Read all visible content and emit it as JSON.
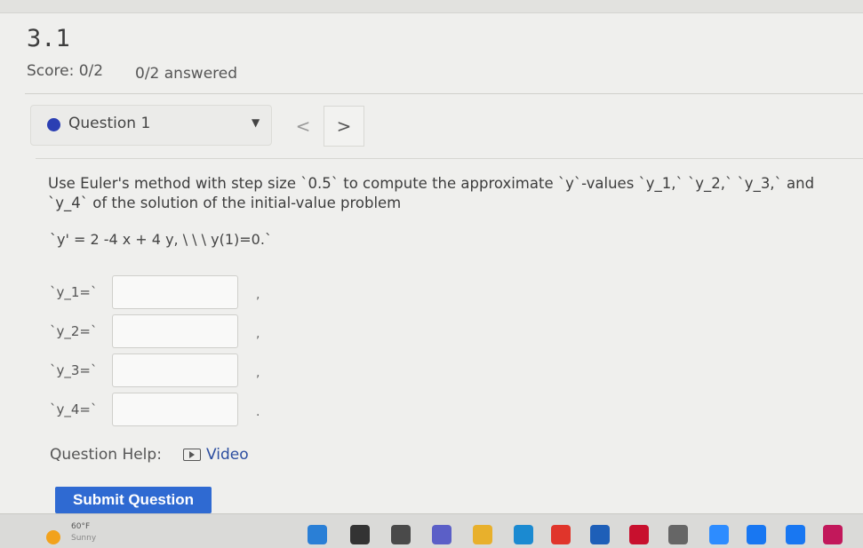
{
  "header": {
    "title": "3.1",
    "score": "Score: 0/2",
    "answered": "0/2 answered"
  },
  "question_nav": {
    "selected": "Question 1",
    "prev_icon": "chevron-left-icon",
    "next_icon": "chevron-right-icon",
    "prev": "<",
    "next": ">",
    "caret": "▼"
  },
  "question": {
    "line1": "Use Euler's method with step size `0.5` to compute the approximate `y`-values `y_1,` `y_2,` `y_3,` and",
    "line2": "`y_4` of the solution of the initial-value problem",
    "equation": "`y' = 2 -4 x + 4 y, \\ \\ \\ y(1)=0.`"
  },
  "answers": [
    {
      "label": "`y_1=`",
      "value": "",
      "punct": ","
    },
    {
      "label": "`y_2=`",
      "value": "",
      "punct": ","
    },
    {
      "label": "`y_3=`",
      "value": "",
      "punct": ","
    },
    {
      "label": "`y_4=`",
      "value": "",
      "punct": "."
    }
  ],
  "help": {
    "label": "Question Help:",
    "video": "Video"
  },
  "submit_label": "Submit Question",
  "taskbar": {
    "temp": "60°F",
    "condition": "Sunny",
    "icons": [
      {
        "name": "windows-start-icon",
        "color": "#2a7fd6"
      },
      {
        "name": "search-icon",
        "color": "#333333"
      },
      {
        "name": "file-explorer-icon",
        "color": "#4a4a4a"
      },
      {
        "name": "teams-chat-icon",
        "color": "#5b5fc7"
      },
      {
        "name": "folder-icon",
        "color": "#e8b02c"
      },
      {
        "name": "edge-browser-icon",
        "color": "#1b8ad1"
      },
      {
        "name": "office-icon",
        "color": "#e0352b"
      },
      {
        "name": "mail-icon",
        "color": "#1e5fb8"
      },
      {
        "name": "mcafee-icon",
        "color": "#c8102e"
      },
      {
        "name": "settings-gear-icon",
        "color": "#666666"
      },
      {
        "name": "zoom-icon",
        "color": "#2d8cff"
      },
      {
        "name": "facebook-icon",
        "color": "#1877f2"
      },
      {
        "name": "facebook-icon-2",
        "color": "#1877f2"
      },
      {
        "name": "photos-icon",
        "color": "#c2185b"
      }
    ]
  }
}
